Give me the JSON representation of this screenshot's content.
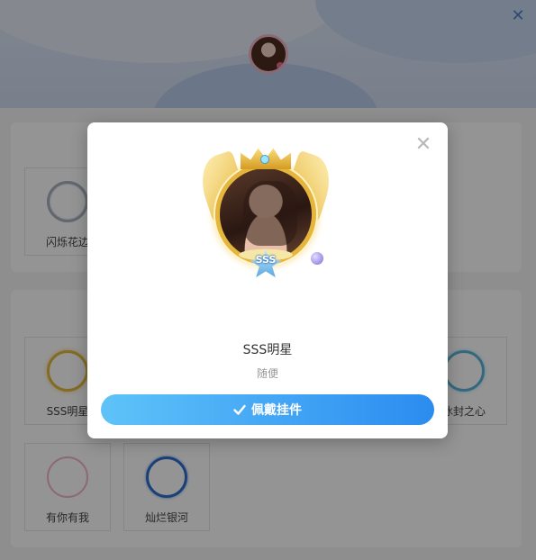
{
  "page": {
    "close_icon": "close-icon",
    "sections": [
      {
        "frames": [
          {
            "name": "闪烁花边",
            "style": "silver"
          }
        ]
      },
      {
        "frames": [
          {
            "name": "SSS明星",
            "style": "gold"
          },
          {
            "name": "冰封之心",
            "style": "ice"
          },
          {
            "name": "有你有我",
            "style": "pink"
          },
          {
            "name": "灿烂银河",
            "style": "blue"
          }
        ]
      }
    ]
  },
  "modal": {
    "close_icon": "close-icon",
    "frame_name": "SSS明星",
    "badge_text": "SSS",
    "description": "随便",
    "wear_button": {
      "label": "佩戴挂件",
      "icon": "check-icon"
    }
  },
  "colors": {
    "accent_start": "#5fc3f9",
    "accent_end": "#2b8cf0",
    "overlay": "rgba(0,0,0,0.42)"
  }
}
